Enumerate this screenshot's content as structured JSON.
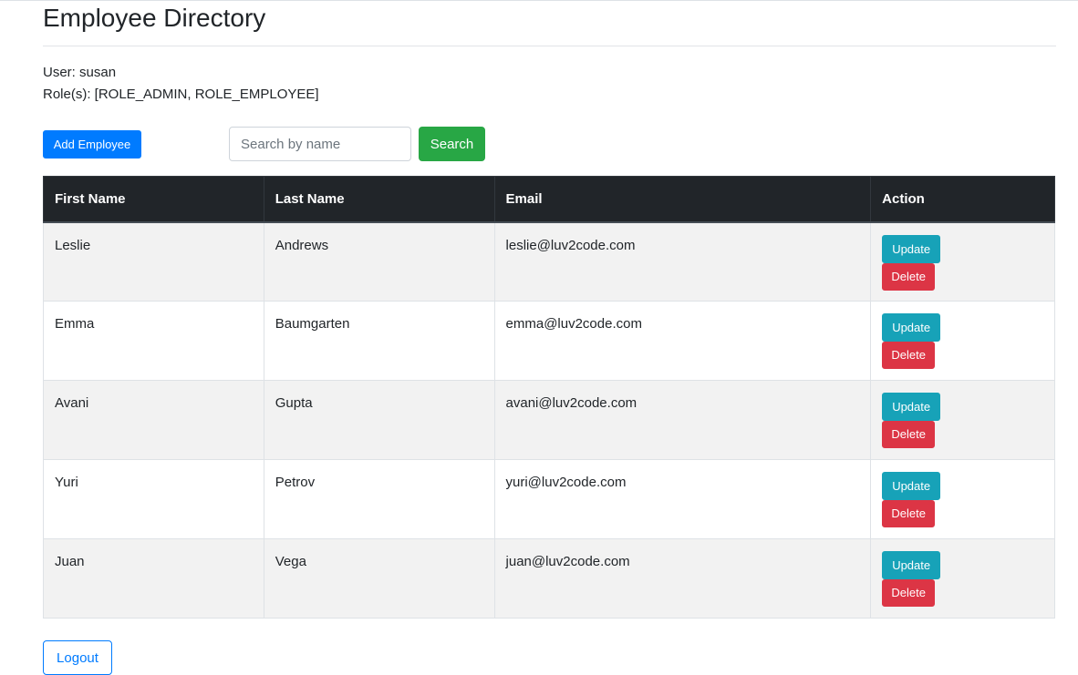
{
  "page": {
    "title": "Employee Directory"
  },
  "user": {
    "line_user": "User: susan",
    "line_roles": "Role(s): [ROLE_ADMIN, ROLE_EMPLOYEE]"
  },
  "toolbar": {
    "add_label": "Add Employee",
    "search_placeholder": "Search by name",
    "search_value": "",
    "search_label": "Search"
  },
  "table": {
    "headers": {
      "first_name": "First Name",
      "last_name": "Last Name",
      "email": "Email",
      "action": "Action"
    },
    "rows": [
      {
        "first_name": "Leslie",
        "last_name": "Andrews",
        "email": "leslie@luv2code.com"
      },
      {
        "first_name": "Emma",
        "last_name": "Baumgarten",
        "email": "emma@luv2code.com"
      },
      {
        "first_name": "Avani",
        "last_name": "Gupta",
        "email": "avani@luv2code.com"
      },
      {
        "first_name": "Yuri",
        "last_name": "Petrov",
        "email": "yuri@luv2code.com"
      },
      {
        "first_name": "Juan",
        "last_name": "Vega",
        "email": "juan@luv2code.com"
      }
    ],
    "update_label": "Update",
    "delete_label": "Delete"
  },
  "footer": {
    "logout_label": "Logout"
  },
  "colors": {
    "primary": "#007bff",
    "success": "#28a745",
    "info": "#17a2b8",
    "danger": "#dc3545",
    "table_header": "#212529",
    "stripe": "#f2f2f2"
  }
}
